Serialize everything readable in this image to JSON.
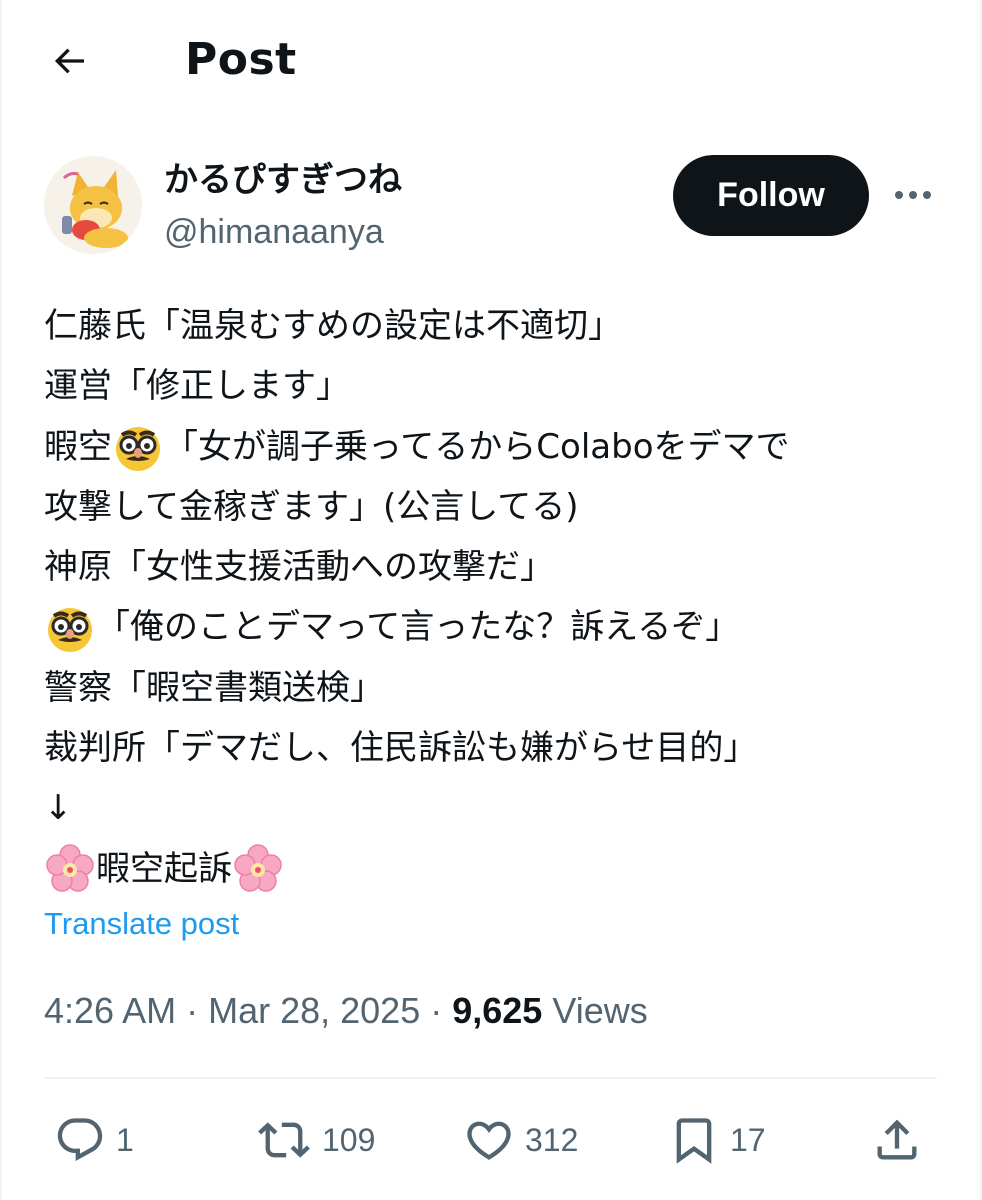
{
  "header": {
    "title": "Post",
    "back_icon": "arrow-left-icon"
  },
  "author": {
    "display_name": "かるぴすぎつね",
    "handle": "@himanaanya",
    "follow_label": "Follow",
    "more_icon": "more-horizontal-icon"
  },
  "post": {
    "lines": [
      "仁藤氏「温泉むすめの設定は不適切」",
      "運営「修正します」",
      "「女が調子乗ってるからColaboをデマで",
      "攻撃して金稼ぎます」(公言してる)",
      "神原「女性支援活動への攻撃だ」",
      "「俺のことデマって言ったな？訴えるぞ」",
      "警察「暇空書類送検」",
      "裁判所「デマだし、住民訴訟も嫌がらせ目的」",
      "↓",
      "暇空起訴"
    ],
    "line3_prefix": "暇空",
    "emojis": {
      "disguise": "disguised-face-emoji",
      "blossom": "cherry-blossom-emoji"
    },
    "translate_label": "Translate post"
  },
  "meta": {
    "time": "4:26 AM",
    "separator": " · ",
    "date": "Mar 28, 2025",
    "views_count": "9,625",
    "views_label": "Views"
  },
  "actions": {
    "reply_count": "1",
    "repost_count": "109",
    "like_count": "312",
    "bookmark_count": "17"
  },
  "colors": {
    "text": "#0f1419",
    "secondary": "#536471",
    "link": "#1d9bf0",
    "follow_bg": "#0f1419",
    "divider": "#eff3f4"
  }
}
